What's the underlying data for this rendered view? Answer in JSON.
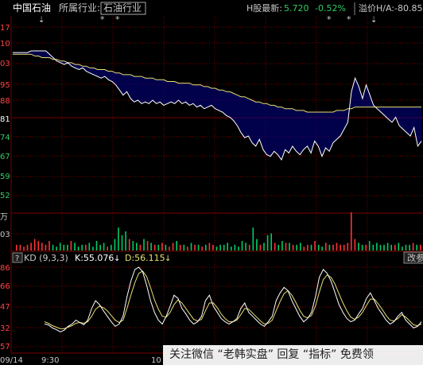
{
  "header": {
    "stock_name": "中国石油",
    "industry_label": "所属行业:",
    "industry_value": "石油行业",
    "h_share_label": "H股最新:",
    "h_share_price": "5.720",
    "h_share_change": "-0.52%",
    "premium_label": "溢价H/A:-80.85"
  },
  "price_axis": {
    "labels": [
      "17",
      "10",
      "03",
      "95",
      "88",
      "81",
      "74",
      "67",
      "59",
      "52"
    ]
  },
  "volume_axis": {
    "labels": [
      "万",
      "03"
    ]
  },
  "kd_header": {
    "help": "?",
    "title": "KD (9,3,3)",
    "k_text": "K:55.076",
    "d_text": "D:56.115",
    "edit": "改参"
  },
  "kd_axis": {
    "labels": [
      "86",
      "66",
      "47",
      "32",
      "57"
    ]
  },
  "time_axis": {
    "labels": [
      "09/14",
      "9:30",
      "10"
    ]
  },
  "watermark": {
    "text_prefix": "关注微信",
    "q1": "“老韩实盘”",
    "mid": "回复",
    "q2": "“指标”",
    "suffix": "免费领"
  },
  "colors": {
    "background": "#000000",
    "grid": "#7a0000",
    "price_line": "#ffffff",
    "avg_line": "#e8e070",
    "volume_up": "#ff3333",
    "volume_down": "#00cc66",
    "k_line": "#ffffff",
    "d_line": "#e8e070",
    "label_red": "#ff4444",
    "label_green": "#33cc66",
    "text": "#c8c8c8"
  },
  "chart_data": [
    {
      "type": "line",
      "title": "",
      "series": [
        {
          "name": "",
          "values": [
            85,
            85,
            85,
            85,
            85,
            86,
            86,
            86,
            86,
            86,
            84,
            82,
            80,
            79,
            78,
            79,
            77,
            76,
            75,
            76,
            74,
            73,
            72,
            71,
            70,
            71,
            69,
            68,
            66,
            63,
            60,
            62,
            58,
            56,
            57,
            55,
            56,
            55,
            57,
            55,
            56,
            54,
            55,
            56,
            55,
            57,
            55,
            56,
            54,
            55,
            53,
            54,
            52,
            53,
            54,
            52,
            51,
            50,
            48,
            47,
            45,
            42,
            38,
            35,
            36,
            32,
            30,
            34,
            28,
            25,
            24,
            27,
            25,
            22,
            28,
            26,
            30,
            27,
            25,
            28,
            30,
            26,
            33,
            30,
            24,
            29,
            27,
            32,
            34,
            36,
            40,
            44,
            62,
            70,
            65,
            58,
            66,
            60,
            54,
            52,
            50,
            48,
            46,
            44,
            47,
            42,
            40,
            38,
            36,
            41,
            30,
            33
          ]
        },
        {
          "name": "",
          "values": [
            84,
            84,
            84,
            84,
            84,
            84,
            83,
            83,
            82,
            82,
            82,
            81,
            81,
            80,
            80,
            79,
            79,
            78,
            78,
            77,
            77,
            76,
            76,
            75,
            75,
            75,
            74,
            74,
            73,
            73,
            72,
            72,
            72,
            71,
            71,
            71,
            70,
            70,
            70,
            69,
            69,
            69,
            68,
            68,
            68,
            67,
            67,
            67,
            67,
            66,
            66,
            66,
            65,
            65,
            64,
            64,
            63,
            63,
            62,
            62,
            61,
            60,
            59,
            59,
            58,
            57,
            56,
            56,
            55,
            55,
            54,
            54,
            53,
            53,
            52,
            52,
            52,
            51,
            51,
            51,
            50,
            50,
            50,
            50,
            50,
            50,
            50,
            50,
            51,
            51,
            51,
            52,
            52,
            53,
            53,
            53,
            53,
            53,
            53,
            53,
            53,
            53,
            53,
            53,
            53,
            53,
            53,
            53,
            53,
            53,
            53,
            53
          ]
        }
      ]
    },
    {
      "type": "bar",
      "title": "",
      "values": [
        3,
        3,
        2,
        3,
        4,
        6,
        5,
        4,
        3,
        5,
        3,
        2,
        4,
        3,
        3,
        5,
        4,
        2,
        3,
        3,
        4,
        2,
        5,
        3,
        4,
        2,
        3,
        6,
        12,
        8,
        10,
        6,
        5,
        4,
        3,
        6,
        5,
        4,
        3,
        3,
        4,
        3,
        2,
        4,
        5,
        3,
        3,
        2,
        4,
        3,
        3,
        2,
        3,
        4,
        3,
        2,
        3,
        3,
        4,
        2,
        3,
        2,
        5,
        4,
        3,
        12,
        6,
        3,
        4,
        8,
        9,
        4,
        3,
        5,
        4,
        4,
        3,
        3,
        4,
        2,
        3,
        3,
        5,
        3,
        2,
        4,
        3,
        3,
        4,
        3,
        3,
        4,
        20,
        6,
        4,
        3,
        3,
        5,
        3,
        4,
        3,
        3,
        4,
        3,
        3,
        4,
        2,
        3,
        3,
        4,
        3,
        3
      ]
    },
    {
      "type": "line",
      "title": "",
      "series": [
        {
          "name": "",
          "values": [
            25,
            24,
            20,
            18,
            15,
            17,
            22,
            25,
            30,
            27,
            24,
            30,
            45,
            55,
            50,
            42,
            35,
            28,
            22,
            25,
            35,
            60,
            80,
            95,
            98,
            92,
            75,
            55,
            40,
            30,
            25,
            35,
            48,
            62,
            58,
            45,
            38,
            30,
            25,
            28,
            35,
            55,
            62,
            48,
            40,
            32,
            28,
            25,
            28,
            32,
            45,
            52,
            40,
            35,
            30,
            25,
            22,
            28,
            35,
            55,
            65,
            72,
            68,
            55,
            45,
            35,
            28,
            32,
            40,
            60,
            85,
            95,
            90,
            80,
            65,
            50,
            40,
            32,
            28,
            30,
            38,
            45,
            58,
            65,
            55,
            45,
            38,
            30,
            25,
            28,
            35,
            40,
            30,
            25,
            20,
            22,
            28
          ]
        },
        {
          "name": "",
          "values": [
            28,
            26,
            23,
            21,
            19,
            19,
            21,
            23,
            26,
            27,
            26,
            28,
            35,
            44,
            48,
            46,
            42,
            36,
            30,
            27,
            30,
            45,
            62,
            78,
            90,
            93,
            86,
            72,
            56,
            44,
            35,
            34,
            40,
            50,
            56,
            52,
            45,
            38,
            31,
            29,
            31,
            42,
            52,
            52,
            46,
            38,
            32,
            28,
            28,
            30,
            37,
            45,
            44,
            39,
            34,
            29,
            25,
            26,
            30,
            42,
            54,
            64,
            68,
            62,
            53,
            43,
            35,
            33,
            36,
            48,
            66,
            82,
            88,
            85,
            76,
            64,
            52,
            42,
            34,
            31,
            34,
            40,
            49,
            57,
            57,
            51,
            44,
            36,
            30,
            29,
            32,
            37,
            34,
            29,
            24,
            23,
            25
          ]
        }
      ]
    }
  ]
}
